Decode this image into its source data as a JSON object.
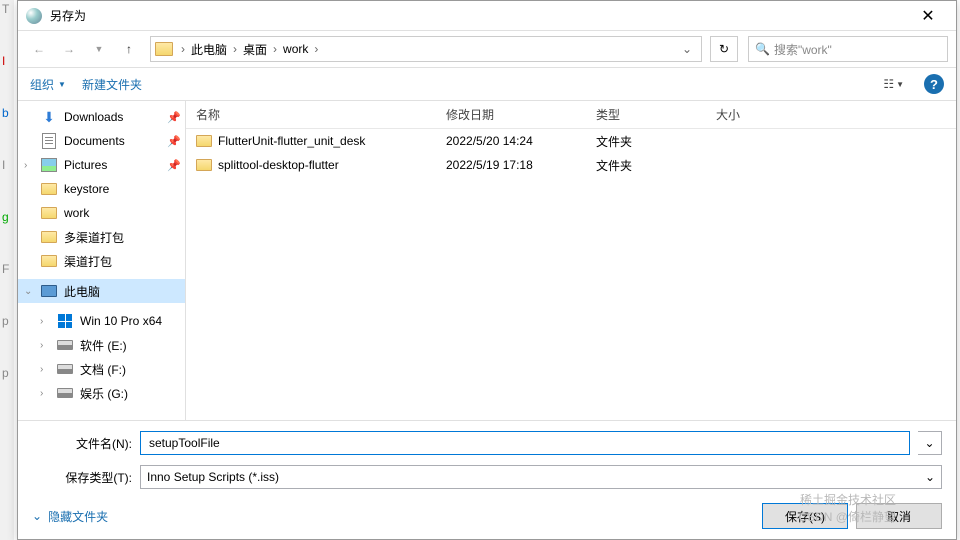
{
  "window": {
    "title": "另存为"
  },
  "bkg_chars": [
    "T",
    "I",
    "b",
    "I",
    "g",
    "F",
    "p",
    "p"
  ],
  "nav": {
    "breadcrumbs": [
      "此电脑",
      "桌面",
      "work"
    ],
    "search_placeholder": "搜索\"work\""
  },
  "toolbar": {
    "organize": "组织",
    "new_folder": "新建文件夹"
  },
  "sidebar": {
    "items": [
      {
        "label": "Downloads",
        "icon": "download",
        "pinned": true
      },
      {
        "label": "Documents",
        "icon": "doc",
        "pinned": true
      },
      {
        "label": "Pictures",
        "icon": "pic",
        "pinned": true
      },
      {
        "label": "keystore",
        "icon": "folder"
      },
      {
        "label": "work",
        "icon": "folder"
      },
      {
        "label": "多渠道打包",
        "icon": "folder"
      },
      {
        "label": "渠道打包",
        "icon": "folder"
      }
    ],
    "this_pc": "此电脑",
    "drives": [
      {
        "label": "Win 10 Pro x64",
        "icon": "win"
      },
      {
        "label": "软件 (E:)",
        "icon": "drive"
      },
      {
        "label": "文档 (F:)",
        "icon": "drive"
      },
      {
        "label": "娱乐 (G:)",
        "icon": "drive"
      }
    ]
  },
  "file_list": {
    "columns": {
      "name": "名称",
      "date": "修改日期",
      "type": "类型",
      "size": "大小"
    },
    "rows": [
      {
        "name": "FlutterUnit-flutter_unit_desk",
        "date": "2022/5/20 14:24",
        "type": "文件夹"
      },
      {
        "name": "splittool-desktop-flutter",
        "date": "2022/5/19 17:18",
        "type": "文件夹"
      }
    ]
  },
  "footer": {
    "filename_label": "文件名(N):",
    "filename_value": "setupToolFile",
    "filetype_label": "保存类型(T):",
    "filetype_value": "Inno Setup Scripts (*.iss)",
    "hide_folders": "隐藏文件夹",
    "save": "保存(S)",
    "cancel": "取消"
  },
  "watermark": {
    "line1": "稀土掘金技术社区",
    "line2": "CSDN @倚栏静望"
  }
}
